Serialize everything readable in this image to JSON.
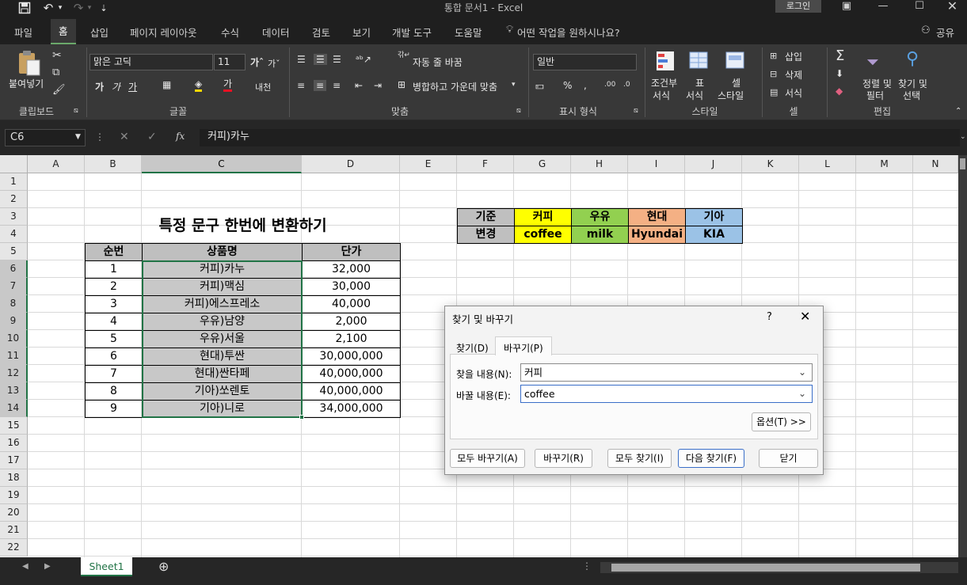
{
  "window": {
    "title": "통합 문서1  -  Excel",
    "login": "로그인"
  },
  "menu": {
    "tabs": [
      "파일",
      "홈",
      "삽입",
      "페이지 레이아웃",
      "수식",
      "데이터",
      "검토",
      "보기",
      "개발 도구",
      "도움말"
    ],
    "tell_me": "어떤 작업을 원하시나요?",
    "share": "공유"
  },
  "ribbon": {
    "paste": "붙여넣기",
    "font_name": "맑은 고딕",
    "font_size": "11",
    "wrap_text": "자동 줄 바꿈",
    "merge_center": "병합하고 가운데 맞춤",
    "number_format": "일반",
    "cond_format_1": "조건부",
    "cond_format_2": "서식",
    "table_fmt_1": "표",
    "table_fmt_2": "서식",
    "cell_style_1": "셀",
    "cell_style_2": "스타일",
    "insert": "삽입",
    "delete": "삭제",
    "format": "서식",
    "sort_1": "정렬 및",
    "sort_2": "필터",
    "find_1": "찾기 및",
    "find_2": "선택",
    "groups": {
      "clipboard": "클립보드",
      "font": "글꼴",
      "align": "맞춤",
      "number": "표시 형식",
      "style": "스타일",
      "cells": "셀",
      "edit": "편집"
    }
  },
  "formula_bar": {
    "name_box": "C6",
    "fx": "fx",
    "content": "커피)카누"
  },
  "columns": [
    "A",
    "B",
    "C",
    "D",
    "E",
    "F",
    "G",
    "H",
    "I",
    "J",
    "K",
    "L",
    "M",
    "N"
  ],
  "rows": [
    "1",
    "2",
    "3",
    "4",
    "5",
    "6",
    "7",
    "8",
    "9",
    "10",
    "11",
    "12",
    "13",
    "14",
    "15",
    "16",
    "17",
    "18",
    "19",
    "20",
    "21",
    "22"
  ],
  "sheet": {
    "title": "특정 문구 한번에 변환하기",
    "table_headers": [
      "순번",
      "상품명",
      "단가"
    ],
    "table_rows": [
      [
        "1",
        "커피)카누",
        "32,000"
      ],
      [
        "2",
        "커피)맥심",
        "30,000"
      ],
      [
        "3",
        "커피)에스프레소",
        "40,000"
      ],
      [
        "4",
        "우유)남양",
        "2,000"
      ],
      [
        "5",
        "우유)서울",
        "2,100"
      ],
      [
        "6",
        "현대)투싼",
        "30,000,000"
      ],
      [
        "7",
        "현대)싼타페",
        "40,000,000"
      ],
      [
        "8",
        "기아)쏘렌토",
        "40,000,000"
      ],
      [
        "9",
        "기아)니로",
        "34,000,000"
      ]
    ],
    "mapping": {
      "label_from": "기준",
      "label_to": "변경",
      "from": [
        "커피",
        "우유",
        "현대",
        "기아"
      ],
      "to": [
        "coffee",
        "milk",
        "Hyundai",
        "KIA"
      ],
      "colors": [
        "#ffff00",
        "#92d050",
        "#f4b084",
        "#9bc2e6"
      ]
    }
  },
  "dialog": {
    "title": "찾기 및 바꾸기",
    "help": "?",
    "tab_find": "찾기(D)",
    "tab_replace": "바꾸기(P)",
    "find_label": "찾을 내용(N):",
    "find_value": "커피",
    "replace_label": "바꿀 내용(E):",
    "replace_value": "coffee",
    "options": "옵션(T) >>",
    "replace_all": "모두 바꾸기(A)",
    "replace": "바꾸기(R)",
    "find_all": "모두 찾기(I)",
    "find_next": "다음 찾기(F)",
    "close": "닫기"
  },
  "status": {
    "sheet_tab": "Sheet1"
  }
}
